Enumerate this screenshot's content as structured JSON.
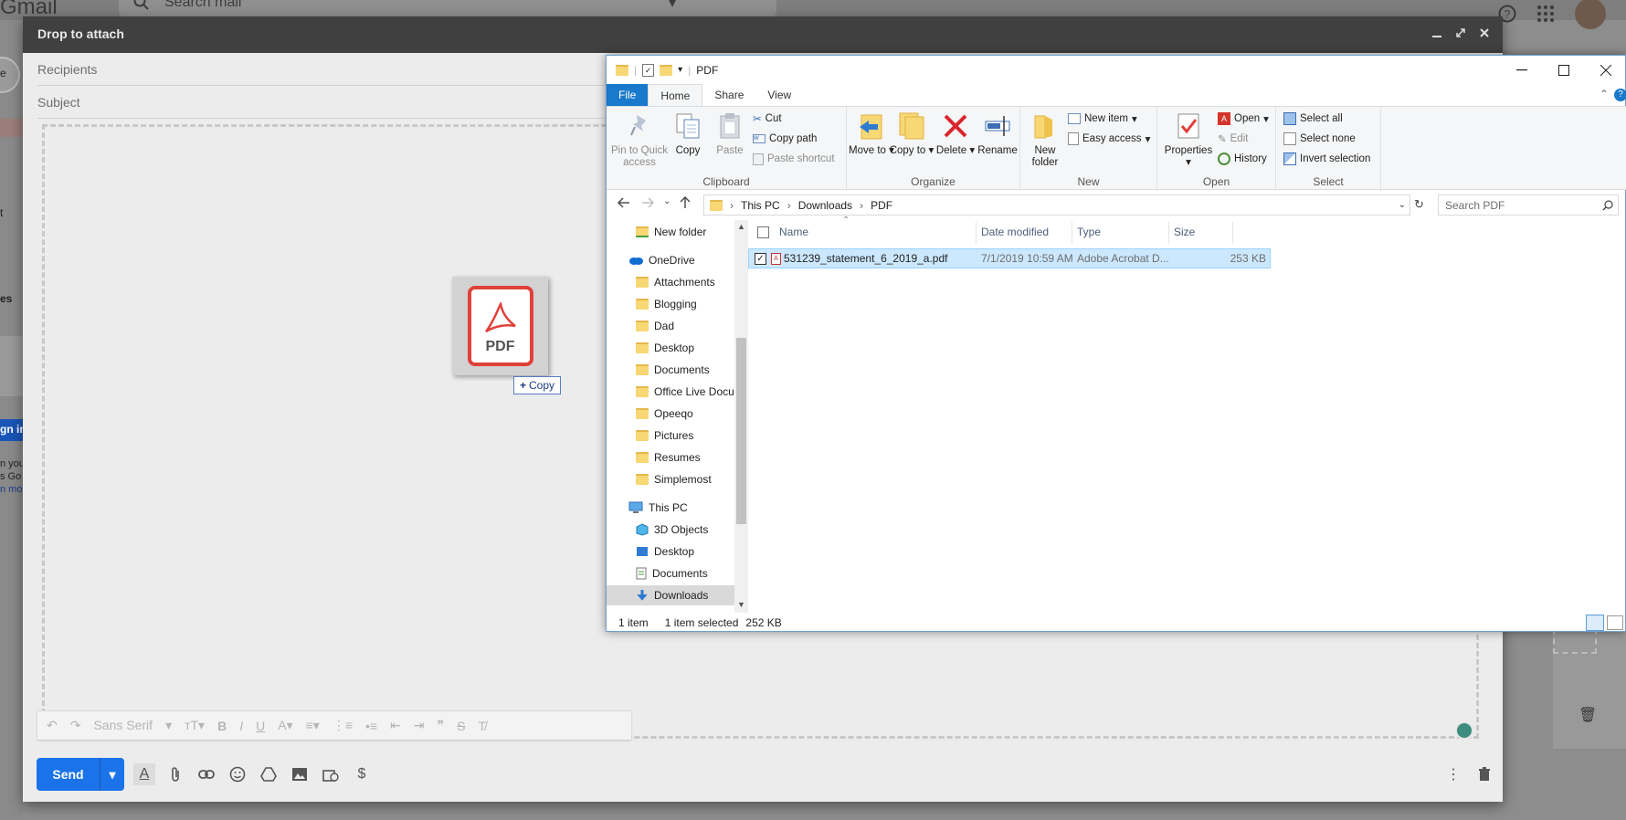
{
  "gmail": {
    "logo": "Gmail",
    "search_placeholder": "Search mail",
    "compose_title": "Drop to attach",
    "recipients_label": "Recipients",
    "subject_label": "Subject",
    "font_name": "Sans Serif",
    "send_label": "Send",
    "left_fragments": [
      "e",
      "t",
      "es",
      "gn in",
      "n you",
      "s Go",
      "n mo"
    ]
  },
  "drag": {
    "ghost_label": "PDF",
    "tooltip_label": "Copy"
  },
  "explorer": {
    "title": "PDF",
    "tabs": [
      "File",
      "Home",
      "Share",
      "View"
    ],
    "active_tab": "Home",
    "ribbon": {
      "clipboard": {
        "label": "Clipboard",
        "pin": "Pin to Quick access",
        "copy": "Copy",
        "paste": "Paste",
        "cut": "Cut",
        "copy_path": "Copy path",
        "paste_shortcut": "Paste shortcut"
      },
      "organize": {
        "label": "Organize",
        "move_to": "Move to",
        "copy_to": "Copy to",
        "delete": "Delete",
        "rename": "Rename"
      },
      "new": {
        "label": "New",
        "new_folder": "New folder",
        "new_item": "New item",
        "easy_access": "Easy access"
      },
      "open": {
        "label": "Open",
        "properties": "Properties",
        "open": "Open",
        "edit": "Edit",
        "history": "History"
      },
      "select": {
        "label": "Select",
        "select_all": "Select all",
        "select_none": "Select none",
        "invert": "Invert selection"
      }
    },
    "address": {
      "crumbs": [
        "This PC",
        "Downloads",
        "PDF"
      ],
      "search_placeholder": "Search PDF"
    },
    "nav": [
      {
        "label": "New folder",
        "icon": "folder-check"
      },
      {
        "label": "OneDrive",
        "icon": "cloud"
      },
      {
        "label": "Attachments",
        "icon": "folder"
      },
      {
        "label": "Blogging",
        "icon": "folder"
      },
      {
        "label": "Dad",
        "icon": "folder"
      },
      {
        "label": "Desktop",
        "icon": "folder"
      },
      {
        "label": "Documents",
        "icon": "folder"
      },
      {
        "label": "Office Live Docu",
        "icon": "folder"
      },
      {
        "label": "Opeeqo",
        "icon": "folder"
      },
      {
        "label": "Pictures",
        "icon": "folder"
      },
      {
        "label": "Resumes",
        "icon": "folder"
      },
      {
        "label": "Simplemost",
        "icon": "folder"
      },
      {
        "label": "This PC",
        "icon": "computer"
      },
      {
        "label": "3D Objects",
        "icon": "cube"
      },
      {
        "label": "Desktop",
        "icon": "desktop"
      },
      {
        "label": "Documents",
        "icon": "document"
      },
      {
        "label": "Downloads",
        "icon": "download"
      }
    ],
    "columns": [
      "Name",
      "Date modified",
      "Type",
      "Size"
    ],
    "files": [
      {
        "name": "531239_statement_6_2019_a.pdf",
        "date": "7/1/2019 10:59 AM",
        "type": "Adobe Acrobat D...",
        "size": "253 KB"
      }
    ],
    "status": {
      "count": "1 item",
      "selected": "1 item selected",
      "size": "252 KB"
    }
  }
}
